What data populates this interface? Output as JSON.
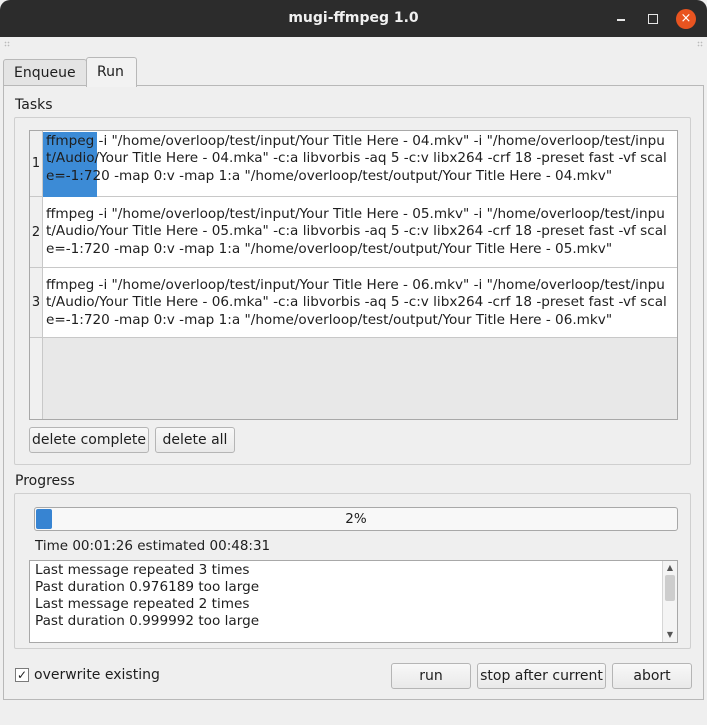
{
  "window": {
    "title": "mugi-ffmpeg 1.0",
    "close_glyph": "×"
  },
  "tabs": [
    {
      "label": "Enqueue",
      "active": false
    },
    {
      "label": "Run",
      "active": true
    }
  ],
  "tasks": {
    "label": "Tasks",
    "rows": [
      {
        "num": "1",
        "first_word": "ffmpeg",
        "rest": " -i \"/home/overloop/test/input/Your Title Here - 04.mkv\" -i \"/home/overloop/test/input/Audio/Your Title Here - 04.mka\" -c:a libvorbis -aq 5 -c:v libx264 -crf 18 -preset fast -vf scale=-1:720 -map 0:v -map 1:a \"/home/overloop/test/output/Your Title Here - 04.mkv\""
      },
      {
        "num": "2",
        "first_word": "ffmpeg",
        "rest": " -i \"/home/overloop/test/input/Your Title Here - 05.mkv\" -i \"/home/overloop/test/input/Audio/Your Title Here - 05.mka\" -c:a libvorbis -aq 5 -c:v libx264 -crf 18 -preset fast -vf scale=-1:720 -map 0:v -map 1:a \"/home/overloop/test/output/Your Title Here - 05.mkv\""
      },
      {
        "num": "3",
        "first_word": "ffmpeg",
        "rest": " -i \"/home/overloop/test/input/Your Title Here - 06.mkv\" -i \"/home/overloop/test/input/Audio/Your Title Here - 06.mka\" -c:a libvorbis -aq 5 -c:v libx264 -crf 18 -preset fast -vf scale=-1:720 -map 0:v -map 1:a \"/home/overloop/test/output/Your Title Here - 06.mkv\""
      }
    ],
    "delete_complete_label": "delete complete",
    "delete_all_label": "delete all"
  },
  "progress": {
    "label": "Progress",
    "percent": 2,
    "text": "2%",
    "time_text": "Time 00:01:26 estimated 00:48:31"
  },
  "log": {
    "lines": [
      "Last message repeated 3 times",
      "Past duration 0.976189 too large",
      "Last message repeated 2 times",
      "Past duration 0.999992 too large"
    ]
  },
  "options": {
    "overwrite_label": "overwrite existing",
    "overwrite_checked": true,
    "check_glyph": "✓"
  },
  "actions": {
    "run_label": "run",
    "stop_label": "stop after current",
    "abort_label": "abort"
  },
  "colors": {
    "titlebar": "#2c2c2c",
    "close_button": "#e95420",
    "selection": "#3c8bd6",
    "progress_fill": "#3784d2"
  }
}
